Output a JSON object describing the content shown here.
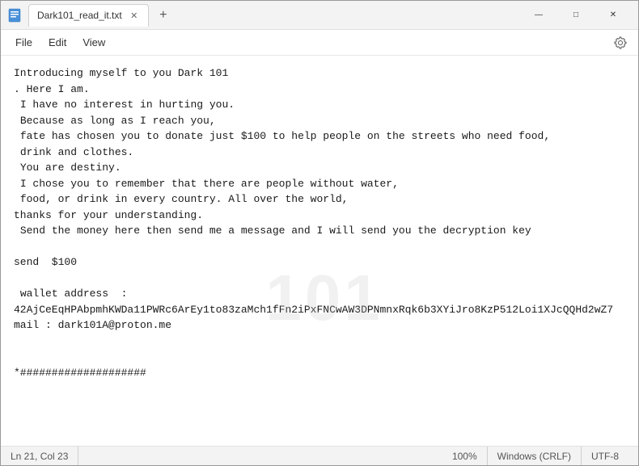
{
  "window": {
    "title": "Dark101_read_it.txt",
    "tab_label": "Dark101_read_it.txt"
  },
  "menu": {
    "file": "File",
    "edit": "Edit",
    "view": "View"
  },
  "content": {
    "text": "Introducing myself to you Dark 101\n. Here I am.\n I have no interest in hurting you.\n Because as long as I reach you,\n fate has chosen you to donate just $100 to help people on the streets who need food,\n drink and clothes.\n You are destiny.\n I chose you to remember that there are people without water,\n food, or drink in every country. All over the world,\nthanks for your understanding.\n Send the money here then send me a message and I will send you the decryption key\n\nsend  $100\n\n wallet address  :\n42AjCeEqHPAbpmhKWDa11PWRc6ArEy1to83zaMch1fFn2iPxFNCwAW3DPNmnxRqk6b3XYiJro8KzP512Loi1XJcQQHd2wZ7\nmail : dark101A@proton.me\n\n\n*####################"
  },
  "statusbar": {
    "position": "Ln 21, Col 23",
    "zoom": "100%",
    "line_ending": "Windows (CRLF)",
    "encoding": "UTF-8"
  },
  "titlebar_controls": {
    "minimize": "—",
    "maximize": "□",
    "close": "✕"
  },
  "icons": {
    "notepad": "📄",
    "settings": "⚙"
  }
}
